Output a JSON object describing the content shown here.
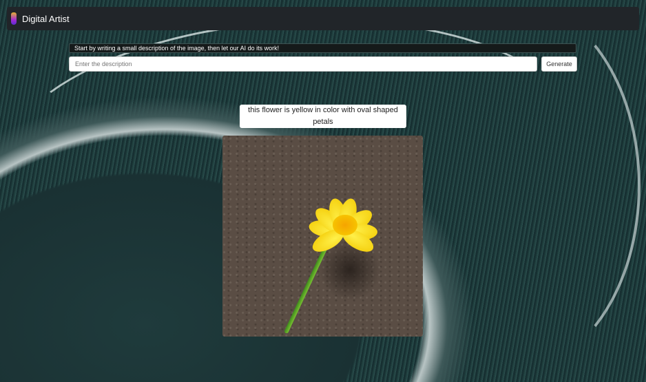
{
  "navbar": {
    "brand": "Digital Artist",
    "logo_icon": "pencil-logo-icon"
  },
  "form": {
    "hint": "Start by writing a small description of the image, then let our AI do its work!",
    "input_value": "",
    "input_placeholder": "Enter the description",
    "generate_label": "Generate"
  },
  "result": {
    "caption": "this flower is yellow in color with oval shaped petals"
  }
}
